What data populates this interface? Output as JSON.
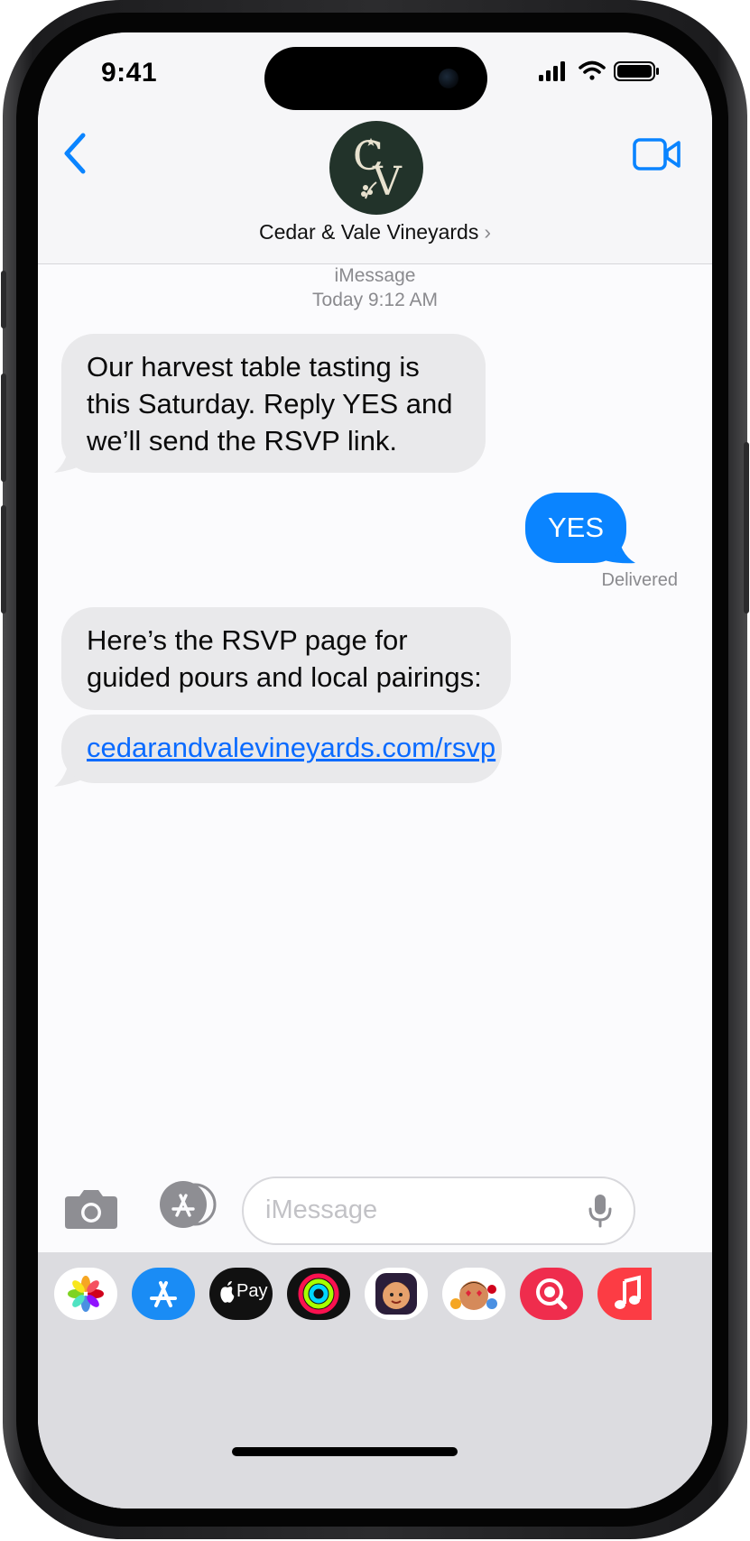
{
  "status_bar": {
    "time": "9:41"
  },
  "header": {
    "contact_name": "Cedar & Vale Vineyards",
    "contact_chevron": "›",
    "avatar_monogram": "CV",
    "back_icon": "chevron-left-icon",
    "video_icon": "facetime-video-icon"
  },
  "conversation": {
    "service": "iMessage",
    "timestamp": "Today 9:12 AM",
    "messages": [
      {
        "direction": "incoming",
        "lines": [
          "Our harvest table tasting is",
          "this Saturday. Reply YES and",
          "we’ll send the RSVP link."
        ]
      },
      {
        "direction": "outgoing",
        "text": "YES",
        "status": "Delivered"
      },
      {
        "direction": "incoming",
        "lines": [
          "Here’s the RSVP page for",
          "guided pours and local pairings:"
        ]
      },
      {
        "direction": "incoming",
        "link": "cedarandvalevineyards.com/rsvp"
      }
    ]
  },
  "composer": {
    "placeholder": "iMessage",
    "camera_icon": "camera-icon",
    "apps_icon": "app-store-icon",
    "mic_icon": "microphone-icon"
  },
  "app_tray": {
    "apps": [
      "photos-icon",
      "app-store-icon",
      "apple-pay-icon",
      "activity-icon",
      "memoji-icon",
      "animoji-icon",
      "search-images-icon",
      "music-icon"
    ],
    "apple_pay_label": "Pay"
  },
  "colors": {
    "accent": "#0a84ff",
    "incoming_bubble": "#e9e9eb",
    "link": "#0a6bff"
  }
}
